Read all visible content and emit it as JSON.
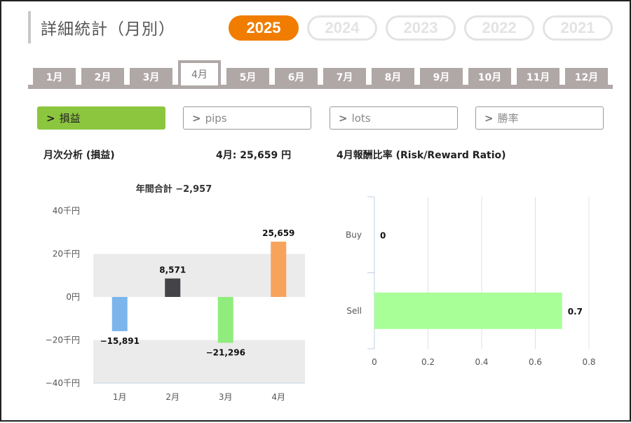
{
  "header": {
    "title": "詳細統計（月別）",
    "years": [
      {
        "label": "2025",
        "active": true
      },
      {
        "label": "2024",
        "active": false
      },
      {
        "label": "2023",
        "active": false
      },
      {
        "label": "2022",
        "active": false
      },
      {
        "label": "2021",
        "active": false
      }
    ]
  },
  "months": [
    {
      "label": "1月",
      "active": false
    },
    {
      "label": "2月",
      "active": false
    },
    {
      "label": "3月",
      "active": false
    },
    {
      "label": "4月",
      "active": true
    },
    {
      "label": "5月",
      "active": false
    },
    {
      "label": "6月",
      "active": false
    },
    {
      "label": "7月",
      "active": false
    },
    {
      "label": "8月",
      "active": false
    },
    {
      "label": "9月",
      "active": false
    },
    {
      "label": "10月",
      "active": false
    },
    {
      "label": "11月",
      "active": false
    },
    {
      "label": "12月",
      "active": false
    }
  ],
  "metric_tabs": [
    {
      "label": "損益",
      "active": true
    },
    {
      "label": "pips",
      "active": false
    },
    {
      "label": "lots",
      "active": false
    },
    {
      "label": "勝率",
      "active": false
    }
  ],
  "left_panel": {
    "heading": "月次分析 (損益)",
    "month_summary": "4月:  25,659 円"
  },
  "right_panel": {
    "heading": "4月報酬比率 (Risk/Reward Ratio)"
  },
  "chart_data": [
    {
      "type": "bar",
      "title": "年間合計 −2,957",
      "categories": [
        "1月",
        "2月",
        "3月",
        "4月"
      ],
      "values": [
        -15891,
        8571,
        -21296,
        25659
      ],
      "value_labels": [
        "−15,891",
        "8,571",
        "−21,296",
        "25,659"
      ],
      "bar_colors": [
        "#7cb5ec",
        "#434348",
        "#90ed7d",
        "#f7a35c"
      ],
      "yticks": [
        40000,
        20000,
        0,
        -20000,
        -40000
      ],
      "ytick_labels": [
        "40千円",
        "20千円",
        "0円",
        "−20千円",
        "−40千円"
      ],
      "ylim": [
        -40000,
        40000
      ],
      "xlabel": "",
      "ylabel": "",
      "grid": "alternating bands"
    },
    {
      "type": "bar",
      "orientation": "horizontal",
      "title": "",
      "categories": [
        "Buy",
        "Sell"
      ],
      "values": [
        0,
        0.7
      ],
      "value_labels": [
        "0",
        "0.7"
      ],
      "bar_color": "#a8ff98",
      "xticks": [
        0,
        0.2,
        0.4,
        0.6,
        0.8
      ],
      "xtick_labels": [
        "0",
        "0.2",
        "0.4",
        "0.6",
        "0.8"
      ],
      "xlim": [
        0,
        0.8
      ],
      "xlabel": "",
      "ylabel": "",
      "grid": "vertical lines"
    }
  ]
}
